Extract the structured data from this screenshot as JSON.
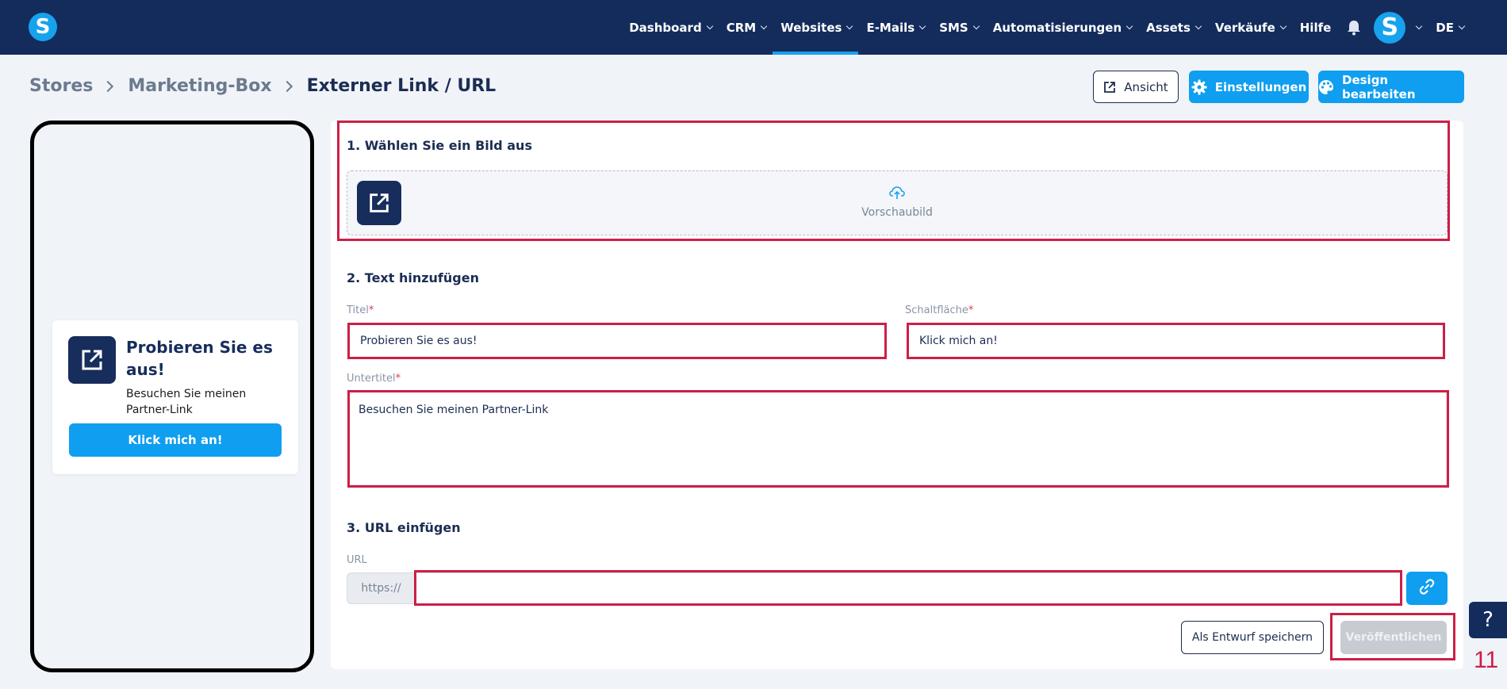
{
  "colors": {
    "nav_bg": "#142c5c",
    "accent": "#0f9ef0",
    "highlight": "#cc1f46",
    "icon_bg": "#172d5c"
  },
  "nav": {
    "logo": "S",
    "items": [
      {
        "label": "Dashboard",
        "dropdown": true
      },
      {
        "label": "CRM",
        "dropdown": true
      },
      {
        "label": "Websites",
        "dropdown": true,
        "active": true
      },
      {
        "label": "E-Mails",
        "dropdown": true
      },
      {
        "label": "SMS",
        "dropdown": true
      },
      {
        "label": "Automatisierungen",
        "dropdown": true
      },
      {
        "label": "Assets",
        "dropdown": true
      },
      {
        "label": "Verkäufe",
        "dropdown": true
      },
      {
        "label": "Hilfe",
        "dropdown": false
      }
    ],
    "bell_icon": "bell-icon",
    "avatar": "S",
    "language": "DE"
  },
  "breadcrumb": [
    "Stores",
    "Marketing-Box",
    "Externer Link / URL"
  ],
  "actions": {
    "view": "Ansicht",
    "settings": "Einstellungen",
    "design": "Design bearbeiten"
  },
  "preview": {
    "title": "Probieren Sie es aus!",
    "subtitle": "Besuchen Sie meinen Partner-Link",
    "button": "Klick mich an!"
  },
  "form": {
    "section1": "1. Wählen Sie ein Bild aus",
    "upload_label": "Vorschaubild",
    "section2": "2. Text hinzufügen",
    "title_label": "Titel",
    "title_value": "Probieren Sie es aus!",
    "button_label": "Schaltfläche",
    "button_value": "Klick mich an!",
    "subtitle_label": "Untertitel",
    "subtitle_value": "Besuchen Sie meinen Partner-Link",
    "required_mark": "*",
    "section3": "3. URL einfügen",
    "url_label": "URL",
    "url_prefix": "https://",
    "url_value": "",
    "save_draft": "Als Entwurf speichern",
    "publish": "Veröffentlichen"
  },
  "help": "?",
  "step_number": "11"
}
